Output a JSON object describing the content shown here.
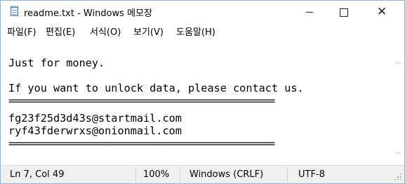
{
  "window": {
    "title": "readme.txt - Windows 메모장",
    "minimize_glyph": "minimize",
    "maximize_glyph": "maximize",
    "close_glyph": "✕"
  },
  "menu": {
    "file": "파일(F)",
    "edit": "편집(E)",
    "format": "서식(O)",
    "view": "보기(V)",
    "help": "도움말(H)"
  },
  "editor": {
    "lines": [
      "Just for money.",
      "",
      "If you want to unlock data, please contact us.",
      "==================================================",
      "fg23f25d3d43s@startmail.com",
      "ryf43fderwrxs@onionmail.com",
      "=================================================="
    ]
  },
  "status": {
    "position": "Ln 7, Col 49",
    "zoom": "100%",
    "line_ending": "Windows (CRLF)",
    "encoding": "UTF-8"
  },
  "icons": {
    "app": "notepad-icon",
    "scroll_up": "chevron-up-icon",
    "scroll_down": "chevron-down-icon",
    "grip": "resize-grip-icon"
  }
}
